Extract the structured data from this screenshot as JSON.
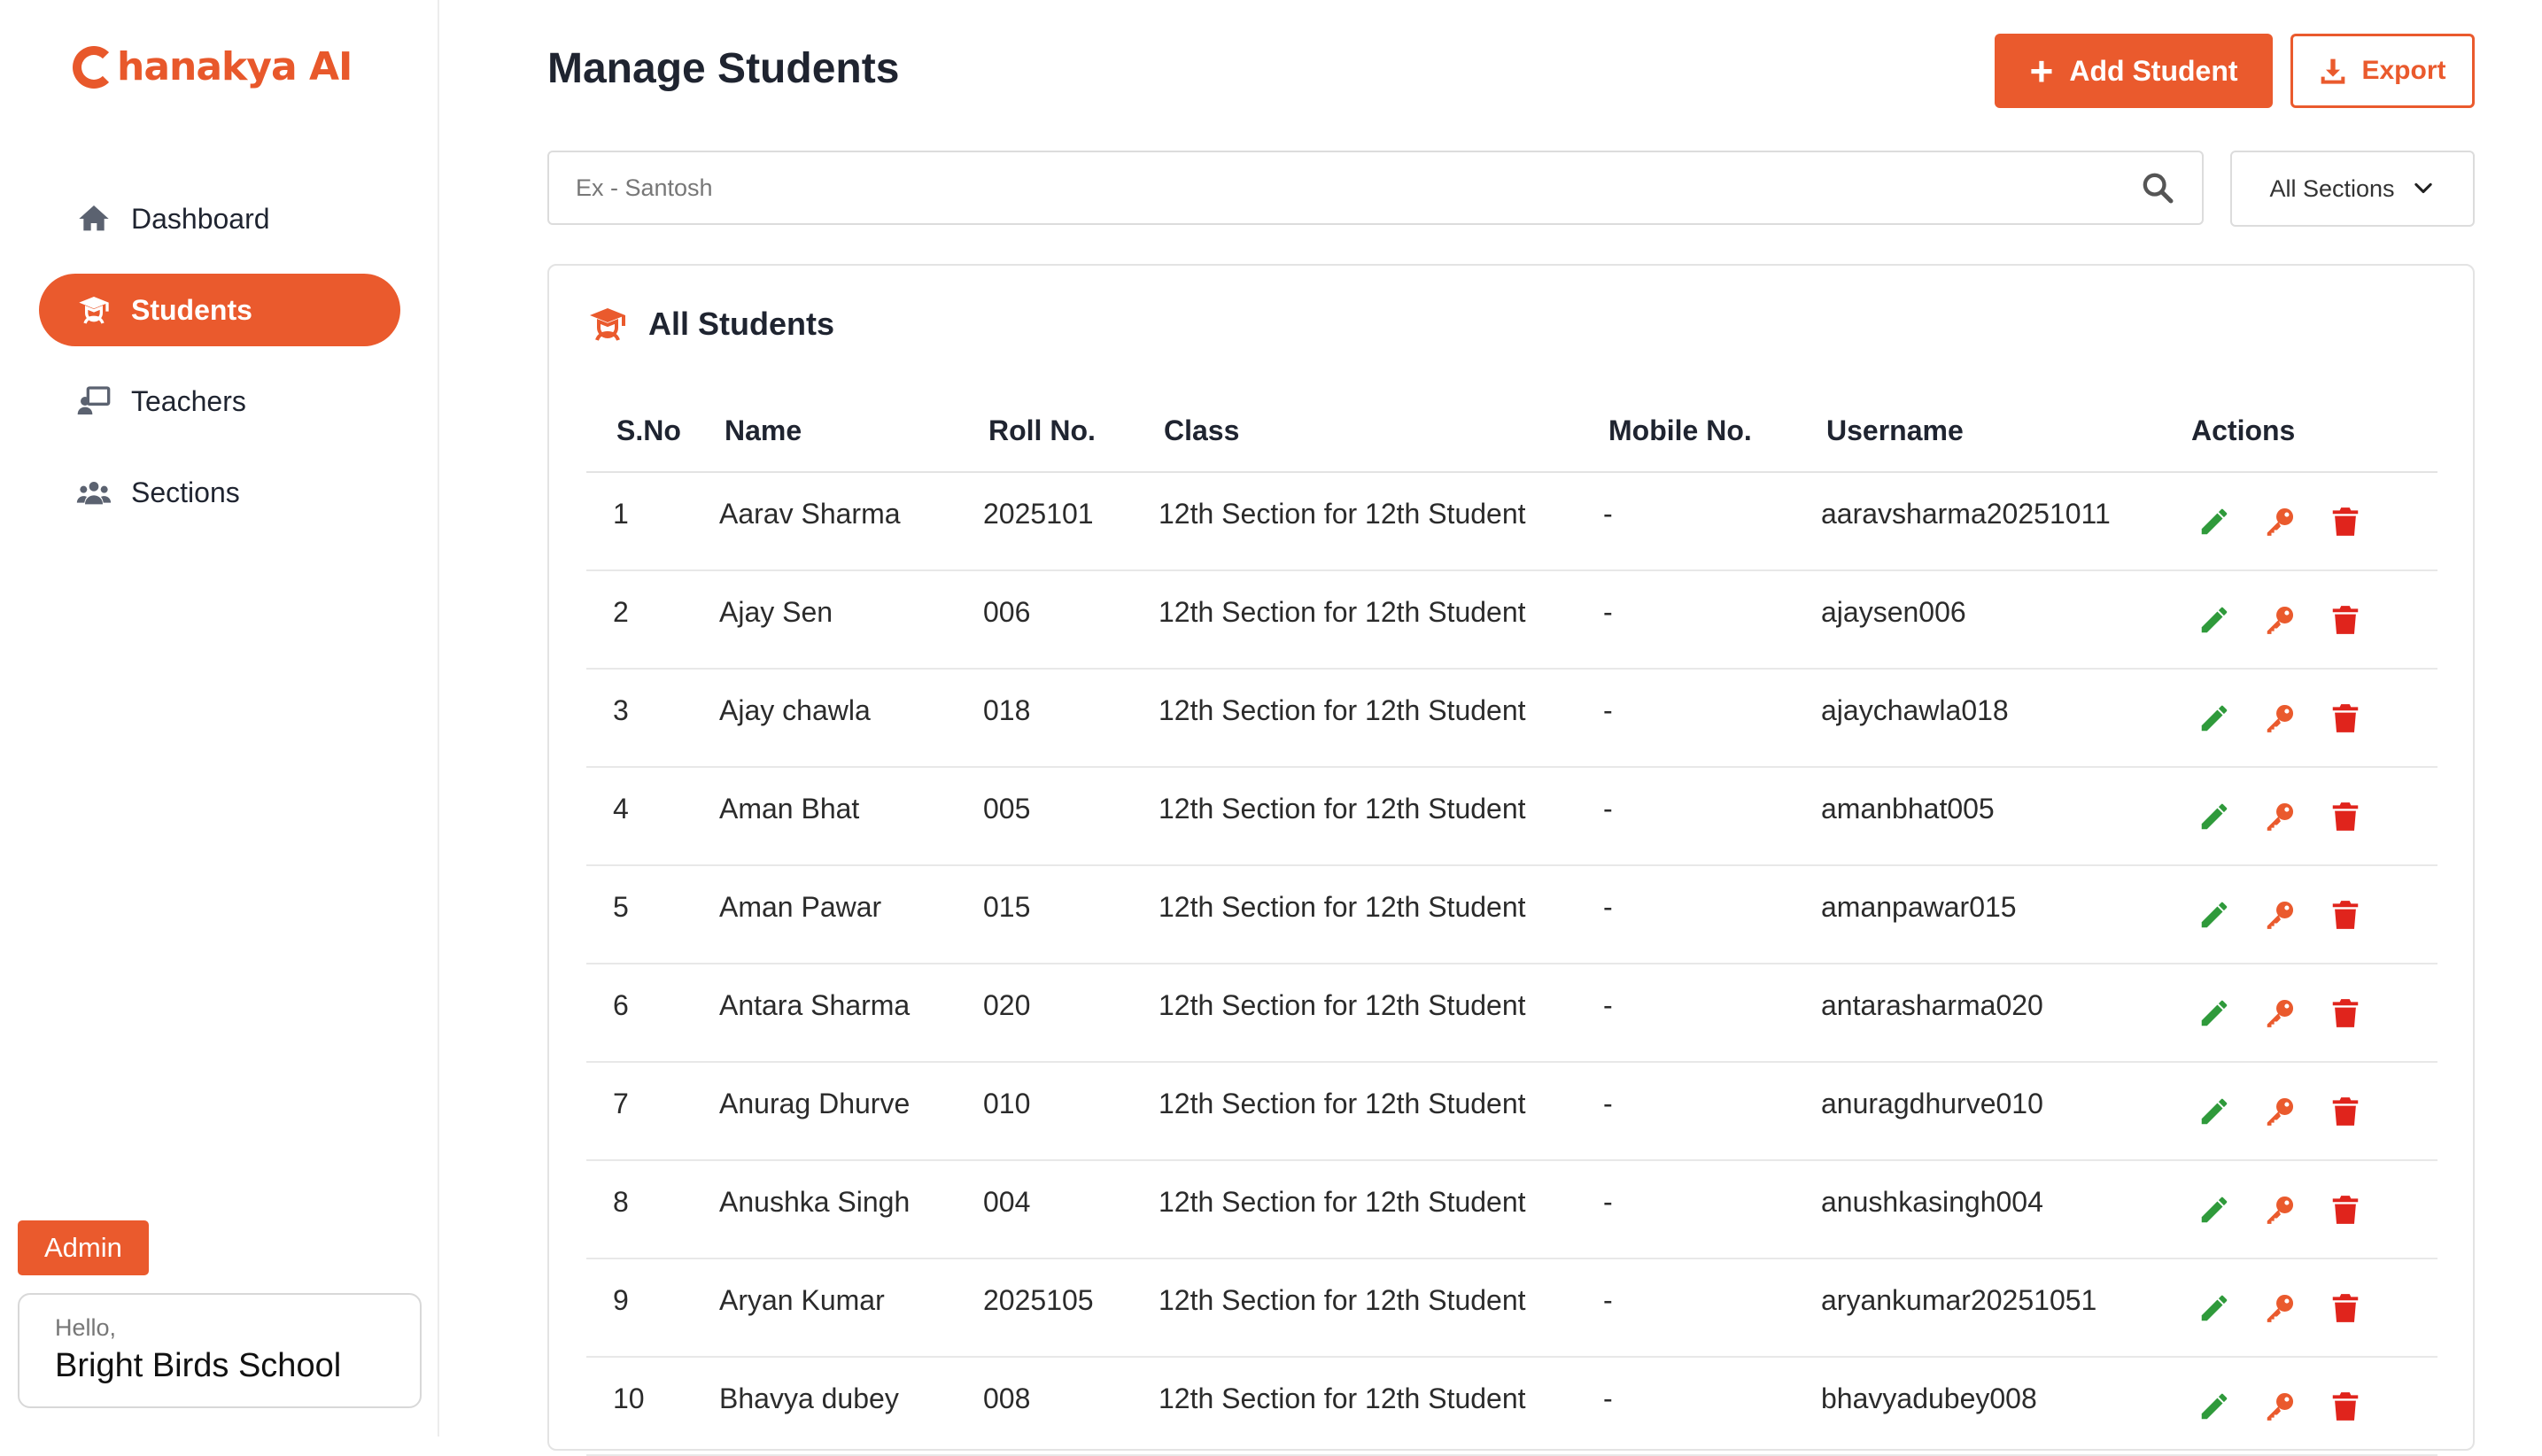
{
  "brand": {
    "name": "hanakya AI",
    "color": "#e8582b"
  },
  "sidebar": {
    "items": [
      {
        "label": "Dashboard",
        "icon": "home-icon",
        "active": false
      },
      {
        "label": "Students",
        "icon": "graduate-icon",
        "active": true
      },
      {
        "label": "Teachers",
        "icon": "teacher-board-icon",
        "active": false
      },
      {
        "label": "Sections",
        "icon": "users-group-icon",
        "active": false
      }
    ],
    "role_badge": "Admin",
    "greeting": "Hello,",
    "school_name": "Bright Birds School"
  },
  "header": {
    "title": "Manage Students",
    "add_label": "Add Student",
    "export_label": "Export"
  },
  "search": {
    "placeholder": "Ex - Santosh",
    "value": ""
  },
  "filter": {
    "selected": "All Sections"
  },
  "panel": {
    "title": "All Students"
  },
  "table": {
    "columns": [
      "S.No",
      "Name",
      "Roll No.",
      "Class",
      "Mobile No.",
      "Username",
      "Actions"
    ],
    "rows": [
      {
        "sno": "1",
        "name": "Aarav Sharma",
        "roll": "2025101",
        "class": "12th Section for 12th Student",
        "mobile": "-",
        "username": "aaravsharma20251011"
      },
      {
        "sno": "2",
        "name": "Ajay Sen",
        "roll": "006",
        "class": "12th Section for 12th Student",
        "mobile": "-",
        "username": "ajaysen006"
      },
      {
        "sno": "3",
        "name": "Ajay chawla",
        "roll": "018",
        "class": "12th Section for 12th Student",
        "mobile": "-",
        "username": "ajaychawla018"
      },
      {
        "sno": "4",
        "name": "Aman Bhat",
        "roll": "005",
        "class": "12th Section for 12th Student",
        "mobile": "-",
        "username": "amanbhat005"
      },
      {
        "sno": "5",
        "name": "Aman Pawar",
        "roll": "015",
        "class": "12th Section for 12th Student",
        "mobile": "-",
        "username": "amanpawar015"
      },
      {
        "sno": "6",
        "name": "Antara Sharma",
        "roll": "020",
        "class": "12th Section for 12th Student",
        "mobile": "-",
        "username": "antarasharma020"
      },
      {
        "sno": "7",
        "name": "Anurag Dhurve",
        "roll": "010",
        "class": "12th Section for 12th Student",
        "mobile": "-",
        "username": "anuragdhurve010"
      },
      {
        "sno": "8",
        "name": "Anushka Singh",
        "roll": "004",
        "class": "12th Section for 12th Student",
        "mobile": "-",
        "username": "anushkasingh004"
      },
      {
        "sno": "9",
        "name": "Aryan Kumar",
        "roll": "2025105",
        "class": "12th Section for 12th Student",
        "mobile": "-",
        "username": "aryankumar20251051"
      },
      {
        "sno": "10",
        "name": "Bhavya dubey",
        "roll": "008",
        "class": "12th Section for 12th Student",
        "mobile": "-",
        "username": "bhavyadubey008"
      }
    ],
    "actions": [
      "edit-icon",
      "key-icon",
      "trash-icon"
    ]
  },
  "colors": {
    "accent": "#ea5a2d",
    "edit": "#2f9a3b",
    "key": "#ea5a2d",
    "delete": "#e0241c"
  }
}
